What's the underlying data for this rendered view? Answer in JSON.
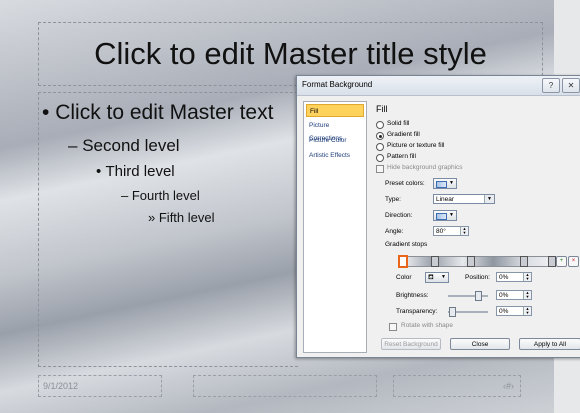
{
  "slide": {
    "title": "Click to edit Master title style",
    "levels": {
      "l1": "Click to edit Master text",
      "l2": "Second level",
      "l3": "Third level",
      "l4": "Fourth level",
      "l5": "Fifth level"
    },
    "bullets": {
      "l1": "•",
      "l2": "–",
      "l3": "•",
      "l4": "–",
      "l5": "»"
    },
    "footer": {
      "date": "9/1/2012",
      "number": "‹#›"
    }
  },
  "dialog": {
    "title": "Format Background",
    "help": "?",
    "close_x": "✕",
    "nav": [
      "Fill",
      "Picture Corrections",
      "Picture Color",
      "Artistic Effects"
    ],
    "section": "Fill",
    "fill_options": [
      "Solid fill",
      "Gradient fill",
      "Picture or texture fill",
      "Pattern fill"
    ],
    "selected_fill": "Gradient fill",
    "hide_bg_label": "Hide background graphics",
    "preset_label": "Preset colors:",
    "type_label": "Type:",
    "type_value": "Linear",
    "direction_label": "Direction:",
    "angle_label": "Angle:",
    "angle_value": "80°",
    "stops_label": "Gradient stops",
    "color_label": "Color",
    "position_label": "Position:",
    "position_value": "0%",
    "brightness_label": "Brightness:",
    "brightness_value": "0%",
    "transparency_label": "Transparency:",
    "transparency_value": "0%",
    "rotate_label": "Rotate with shape",
    "reset_button": "Reset Background",
    "close_button": "Close",
    "apply_button": "Apply to All"
  }
}
